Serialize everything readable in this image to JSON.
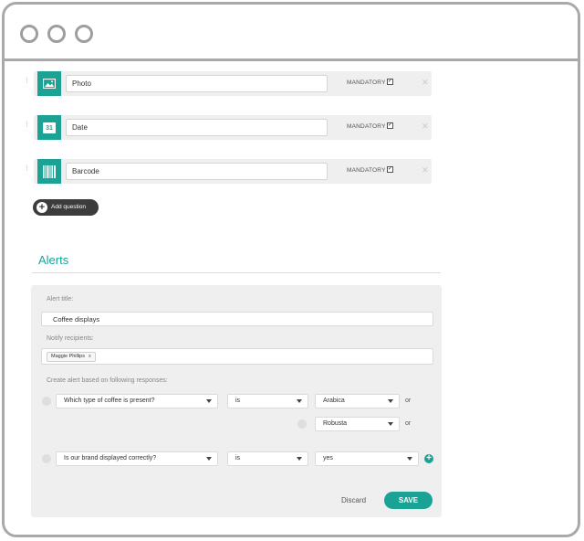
{
  "questions": [
    {
      "label": "Photo",
      "icon": "photo-icon",
      "mandatory_label": "MANDATORY",
      "mandatory": true
    },
    {
      "label": "Date",
      "icon": "calendar-icon",
      "calendar_day": "31",
      "mandatory_label": "MANDATORY",
      "mandatory": true
    },
    {
      "label": "Barcode",
      "icon": "barcode-icon",
      "mandatory_label": "MANDATORY",
      "mandatory": true
    }
  ],
  "add_question_label": "Add question",
  "alerts": {
    "heading": "Alerts",
    "title_label": "Alert title:",
    "title_value": "Coffee displays",
    "recipients_label": "Notify recipients:",
    "recipient_chip": "Maggie Phillips",
    "recipient_remove": "x",
    "create_label": "Create alert based on following responses:",
    "conditions": [
      {
        "question": "Which type of coffee is present?",
        "operator": "is",
        "answers": [
          "Arabica",
          "Robusta"
        ],
        "joiner": "or"
      },
      {
        "question": "Is our brand displayed correctly?",
        "operator": "is",
        "answers": [
          "yes"
        ]
      }
    ],
    "discard_label": "Discard",
    "save_label": "SAVE"
  },
  "colors": {
    "accent": "#1aa394",
    "dark_button": "#3c3c3c"
  }
}
